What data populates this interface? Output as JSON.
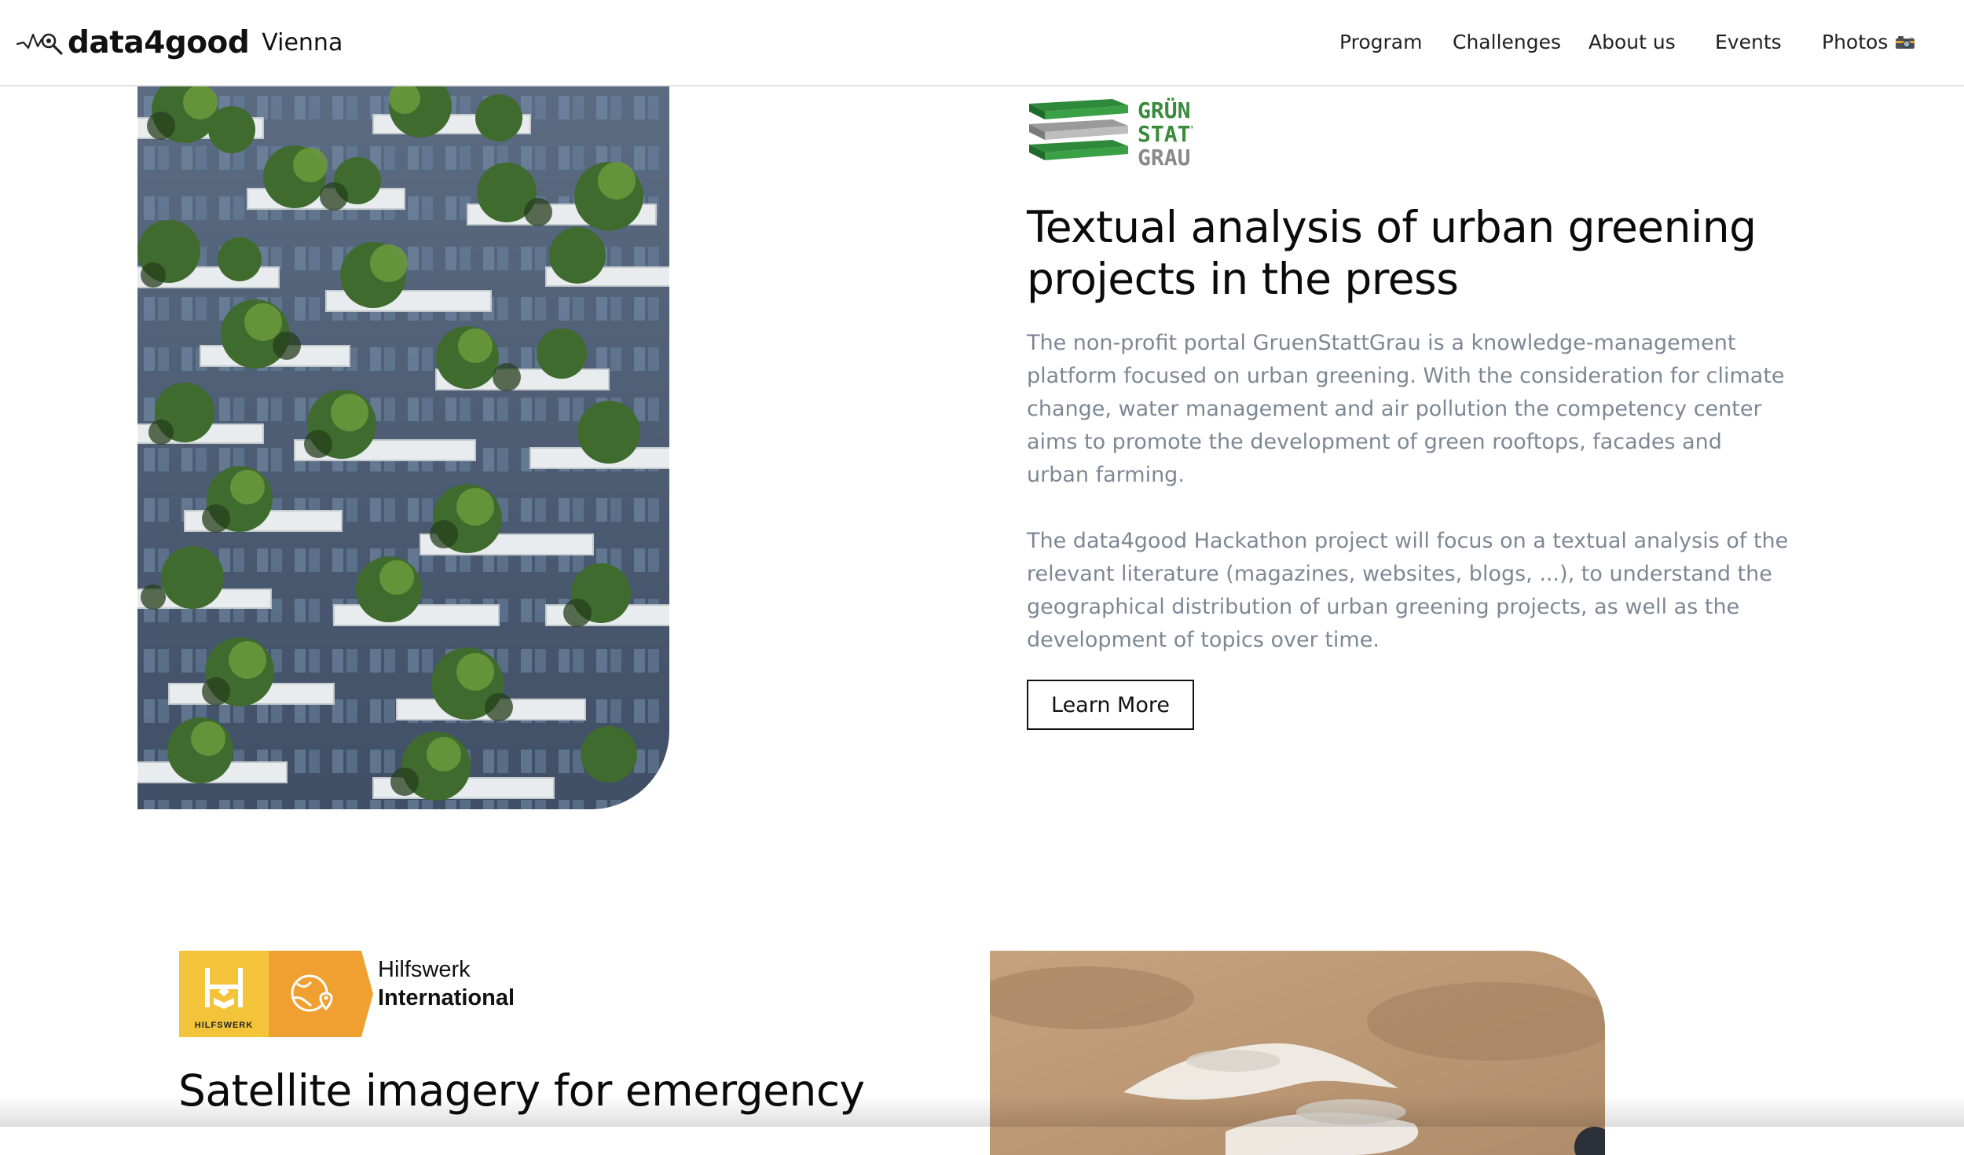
{
  "header": {
    "brand_name": "data4good",
    "brand_city": "Vienna",
    "nav": [
      "Program",
      "Challenges",
      "About us",
      "Events",
      "Photos"
    ]
  },
  "section1": {
    "logo_lines": [
      "GRÜN",
      "STATT",
      "GRAU"
    ],
    "title_line1": "Textual analysis of urban greening",
    "title_line2": "projects in the press",
    "paragraph1": "The non-profit portal GruenStattGrau is a knowledge-management platform focused on urban greening. With the consideration for climate change, water management and air pollution the competency center aims to promote the development of green rooftops, facades and urban farming.",
    "paragraph2": "The data4good Hackathon project will focus on a textual analysis of the relevant literature (magazines, websites, blogs, ...), to understand the geographical distribution of urban greening projects, as well as the development of topics over time.",
    "button_label": "Learn More"
  },
  "section2": {
    "logo_small_label": "HILFSWERK",
    "logo_name_line1": "Hilfswerk",
    "logo_name_line2": "International",
    "title": "Satellite imagery for emergency"
  },
  "colors": {
    "body_text": "#7d8794",
    "green": "#3a8a3c",
    "grey_logo": "#8a8a8a",
    "hilfswerk_yellow": "#f3c43a",
    "hilfswerk_orange": "#f0a030"
  }
}
